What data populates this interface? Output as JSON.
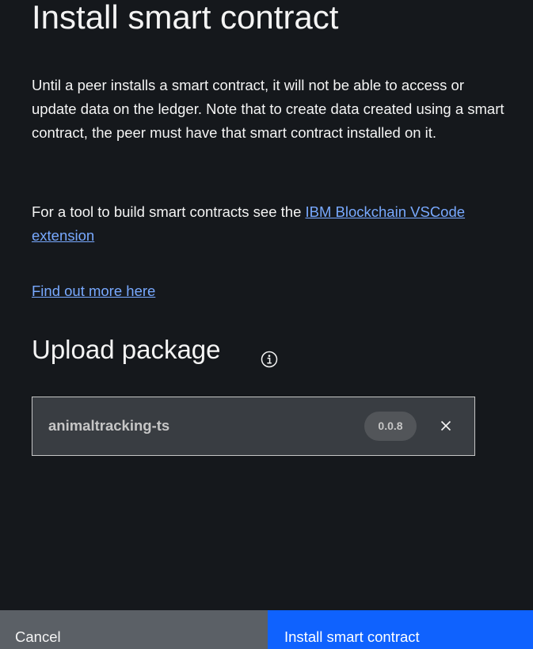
{
  "header": {
    "title": "Install smart contract"
  },
  "intro": {
    "description": "Until a peer installs a smart contract, it will not be able to access or update data on the ledger. Note that to create data created using a smart contract, the peer must have that smart contract installed on it."
  },
  "tool": {
    "prefix": "For a tool to build smart contracts see the ",
    "link_label": "IBM Blockchain VSCode extension"
  },
  "find_more": {
    "link_label": "Find out more here"
  },
  "upload": {
    "title": "Upload package",
    "info_icon": "information-icon",
    "package": {
      "name": "animaltracking-ts",
      "version": "0.0.8",
      "remove_icon": "close-icon"
    }
  },
  "footer": {
    "cancel_label": "Cancel",
    "submit_label": "Install smart contract"
  },
  "colors": {
    "background": "#15181c",
    "link": "#78a9ff",
    "primary": "#0f62fe",
    "secondary": "#5b6066",
    "tile": "#393d42"
  }
}
